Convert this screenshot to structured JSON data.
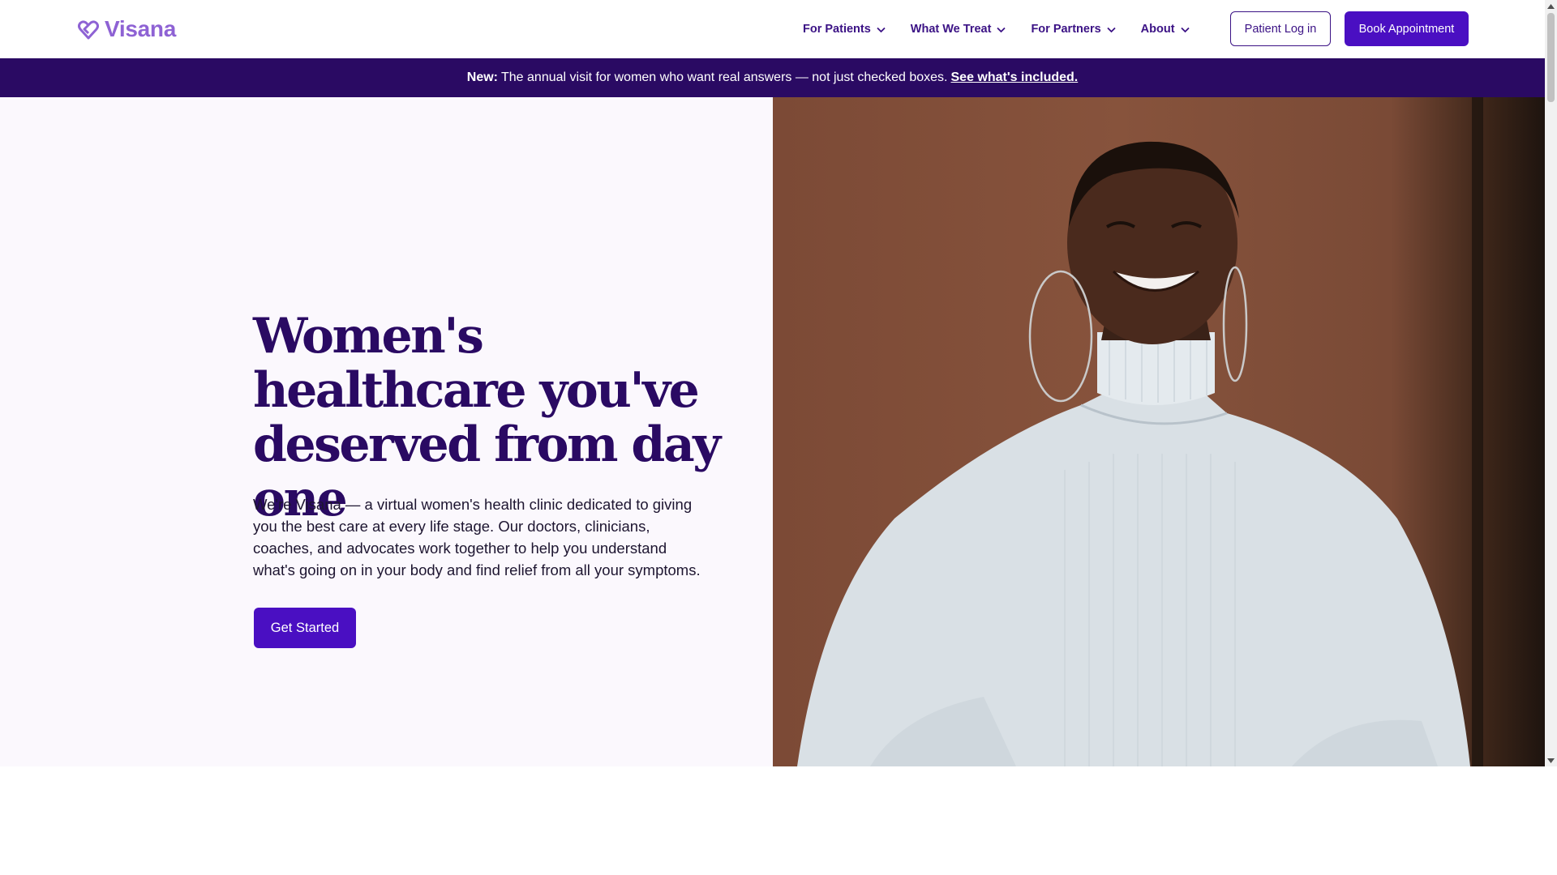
{
  "brand": {
    "name": "Visana",
    "logo_color": "#8e62d4",
    "primary_color": "#4a0fc2",
    "dark_color": "#2a0a63"
  },
  "nav": {
    "items": [
      {
        "label": "For Patients",
        "icon": "chevron-down-icon"
      },
      {
        "label": "What We Treat",
        "icon": "chevron-down-icon"
      },
      {
        "label": "For Partners",
        "icon": "chevron-down-icon"
      },
      {
        "label": "About",
        "icon": "chevron-down-icon"
      }
    ],
    "login_label": "Patient Log in",
    "book_label": "Book Appointment"
  },
  "banner": {
    "new_label": "New",
    "separator": " :",
    "message": "The annual visit for women who want real answers — not just checked boxes.",
    "link_label": "See what's included."
  },
  "hero": {
    "title": "Women's healthcare you've deserved from day one",
    "body": "We're Visana — a virtual women's health clinic dedicated to giving you the best care at every life stage. Our doctors, clinicians, coaches, and advocates work together to help you understand what's going on in your body and find relief from all your symptoms.",
    "cta_label": "Get Started",
    "image_subject": "smiling-woman-photo"
  },
  "scrollbar": {
    "up_icon": "scroll-up-arrow-icon",
    "down_icon": "scroll-down-arrow-icon"
  }
}
